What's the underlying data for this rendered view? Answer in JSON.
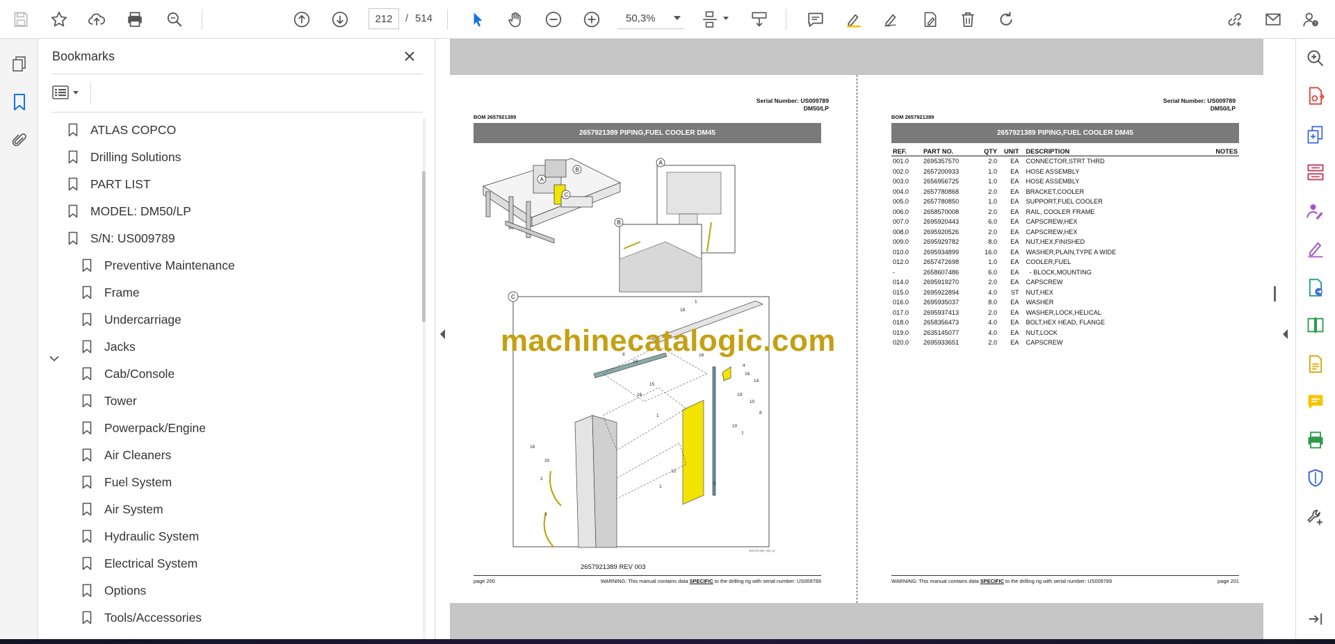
{
  "toolbar": {
    "current_page": "212",
    "page_separator": "/",
    "total_pages": "514",
    "zoom": "50,3%"
  },
  "bookmarks": {
    "title": "Bookmarks",
    "items": [
      {
        "label": "ATLAS COPCO"
      },
      {
        "label": "Drilling Solutions"
      },
      {
        "label": "PART LIST"
      },
      {
        "label": "MODEL: DM50/LP"
      },
      {
        "label": "S/N: US009789"
      },
      {
        "label": "Preventive Maintenance"
      },
      {
        "label": "Frame"
      },
      {
        "label": "Undercarriage"
      },
      {
        "label": "Jacks"
      },
      {
        "label": "Cab/Console"
      },
      {
        "label": "Tower"
      },
      {
        "label": "Powerpack/Engine"
      },
      {
        "label": "Air Cleaners"
      },
      {
        "label": "Fuel System"
      },
      {
        "label": "Air System"
      },
      {
        "label": "Hydraulic System"
      },
      {
        "label": "Electrical System"
      },
      {
        "label": "Options"
      },
      {
        "label": "Tools/Accessories"
      }
    ]
  },
  "document": {
    "left_page": {
      "serial_number": "Serial Number: US009789",
      "model": "DM50/LP",
      "bom": "BOM 2657921389",
      "banner": "2657921389 PIPING,FUEL COOLER DM45",
      "view_labels": {
        "a": "A",
        "b": "B",
        "c": "C"
      },
      "rev": "2657921389 REV 003",
      "footer_page": "page 200",
      "warning_pre": "WARNING:  This manual contains data ",
      "warning_emph": "SPECIFIC",
      "warning_post": " to the drilling rig with serial number: US009789"
    },
    "right_page": {
      "serial_number": "Serial Number: US009789",
      "model": "DM50/LP",
      "bom": "BOM 2657921389",
      "banner": "2657921389 PIPING,FUEL COOLER DM45",
      "footer_page": "page 201",
      "warning_pre": "WARNING:  This manual contains data ",
      "warning_emph": "SPECIFIC",
      "warning_post": " to the drilling rig with serial number: US009789",
      "table_headers": {
        "ref": "REF.",
        "part": "PART NO.",
        "qty": "QTY",
        "unit": "UNIT",
        "desc": "DESCRIPTION",
        "notes": "NOTES"
      },
      "parts": [
        {
          "ref": "001.0",
          "part": "2695357570",
          "qty": "2.0",
          "unit": "EA",
          "desc": "CONNECTOR,STRT THRD"
        },
        {
          "ref": "002.0",
          "part": "2657200933",
          "qty": "1.0",
          "unit": "EA",
          "desc": "HOSE ASSEMBLY"
        },
        {
          "ref": "003.0",
          "part": "2656956725",
          "qty": "1.0",
          "unit": "EA",
          "desc": "HOSE ASSEMBLY"
        },
        {
          "ref": "004.0",
          "part": "2657780868",
          "qty": "2.0",
          "unit": "EA",
          "desc": "BRACKET,COOLER"
        },
        {
          "ref": "005.0",
          "part": "2657780850",
          "qty": "1.0",
          "unit": "EA",
          "desc": "SUPPORT,FUEL COOLER"
        },
        {
          "ref": "006.0",
          "part": "2658570008",
          "qty": "2.0",
          "unit": "EA",
          "desc": "RAIL, COOLER FRAME"
        },
        {
          "ref": "007.0",
          "part": "2695920443",
          "qty": "6.0",
          "unit": "EA",
          "desc": "CAPSCREW,HEX"
        },
        {
          "ref": "008.0",
          "part": "2695920526",
          "qty": "2.0",
          "unit": "EA",
          "desc": "CAPSCREW,HEX"
        },
        {
          "ref": "009.0",
          "part": "2695929782",
          "qty": "8.0",
          "unit": "EA",
          "desc": "NUT,HEX,FINISHED"
        },
        {
          "ref": "010.0",
          "part": "2695934899",
          "qty": "16.0",
          "unit": "EA",
          "desc": "WASHER,PLAIN,TYPE A WIDE"
        },
        {
          "ref": "012.0",
          "part": "2657472698",
          "qty": "1.0",
          "unit": "EA",
          "desc": "COOLER,FUEL"
        },
        {
          "ref": "-",
          "part": "2658607486",
          "qty": "6.0",
          "unit": "EA",
          "desc": "  - BLOCK,MOUNTING"
        },
        {
          "ref": "014.0",
          "part": "2695919270",
          "qty": "2.0",
          "unit": "EA",
          "desc": "CAPSCREW"
        },
        {
          "ref": "015.0",
          "part": "2695922894",
          "qty": "4.0",
          "unit": "ST",
          "desc": "NUT,HEX"
        },
        {
          "ref": "016.0",
          "part": "2695935037",
          "qty": "8.0",
          "unit": "EA",
          "desc": "WASHER"
        },
        {
          "ref": "017.0",
          "part": "2695937413",
          "qty": "2.0",
          "unit": "EA",
          "desc": "WASHER,LOCK,HELICAL"
        },
        {
          "ref": "018.0",
          "part": "2658356473",
          "qty": "4.0",
          "unit": "EA",
          "desc": "BOLT,HEX HEAD, FLANGE"
        },
        {
          "ref": "019.0",
          "part": "2635145077",
          "qty": "4.0",
          "unit": "EA",
          "desc": "NUT,LOCK"
        },
        {
          "ref": "020.0",
          "part": "2695933651",
          "qty": "2.0",
          "unit": "EA",
          "desc": "CAPSCREW"
        }
      ]
    },
    "watermark": "machinecatalogic.com"
  },
  "colors": {
    "accent_blue": "#1473e6",
    "doc_gray": "#c6c6c6",
    "banner_gray": "#7a7a7a",
    "watermark_gold": "#c4a012",
    "cooler_yellow": "#f2e300"
  },
  "icons": {
    "toolbar": [
      "save-icon",
      "star-icon",
      "upload-icon",
      "print-icon",
      "search-icon",
      "prev-page-icon",
      "next-page-icon",
      "select-cursor-icon",
      "hand-icon",
      "zoom-out-icon",
      "zoom-in-icon",
      "page-fit-icon",
      "scroll-mode-icon",
      "comment-icon",
      "highlight-icon",
      "sign-icon",
      "fill-sign-icon",
      "delete-icon",
      "rotate-icon",
      "share-link-icon",
      "mail-icon",
      "account-help-icon"
    ],
    "right_rail": [
      "zoom-find-icon",
      "export-pdf-icon",
      "create-pdf-icon",
      "organize-pages-icon",
      "edit-pdf-icon",
      "fill-sign-icon",
      "convert-pdf-icon",
      "compare-icon",
      "export-icon",
      "comment-icon",
      "scan-ocr-icon",
      "protect-icon",
      "more-tools-icon",
      "expand-icon"
    ]
  }
}
